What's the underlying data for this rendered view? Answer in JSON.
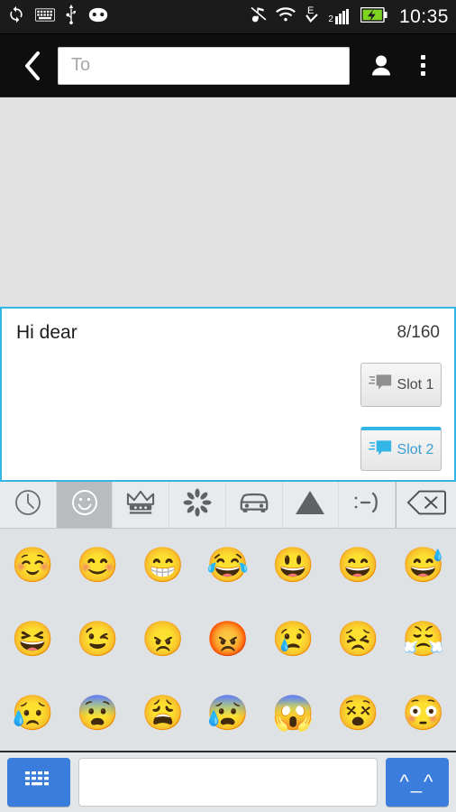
{
  "statusbar": {
    "time": "10:35",
    "signal_label": "2",
    "network_label": "E",
    "left_icons": [
      "sync-icon",
      "keyboard-icon",
      "usb-icon",
      "android-face-icon"
    ],
    "right_icons": [
      "mute-icon",
      "wifi-icon",
      "edge-network-icon",
      "signal-bars-icon",
      "battery-charging-icon"
    ]
  },
  "actionbar": {
    "back_label": "back-chevron",
    "recipient_placeholder": "To",
    "recipient_value": "",
    "contacts_label": "contacts-icon",
    "overflow_label": "overflow-menu-icon"
  },
  "compose": {
    "message": "Hi dear",
    "counter": "8/160",
    "slot1_label": "Slot 1",
    "slot2_label": "Slot 2",
    "accent_color": "#33b5e5",
    "slot2_text_color": "#3b9fd4"
  },
  "keyboard": {
    "categories": [
      {
        "name": "recent",
        "icon": "clock-icon",
        "active": false
      },
      {
        "name": "smileys",
        "icon": "smiley-icon",
        "active": true
      },
      {
        "name": "objects",
        "icon": "crown-icon",
        "active": false
      },
      {
        "name": "nature",
        "icon": "flower-icon",
        "active": false
      },
      {
        "name": "travel",
        "icon": "car-icon",
        "active": false
      },
      {
        "name": "symbols",
        "icon": "triangle-icon",
        "active": false
      },
      {
        "name": "emoticons",
        "icon": "emoticon-icon",
        "label": ":-)",
        "active": false
      }
    ],
    "backspace_label": "backspace-icon",
    "emojis": [
      {
        "name": "relaxed",
        "char": "☺️"
      },
      {
        "name": "blush",
        "char": "😊"
      },
      {
        "name": "grin",
        "char": "😁"
      },
      {
        "name": "joy",
        "char": "😂"
      },
      {
        "name": "smiley",
        "char": "😃"
      },
      {
        "name": "smile",
        "char": "😄"
      },
      {
        "name": "sweat-smile",
        "char": "😅"
      },
      {
        "name": "laughing",
        "char": "😆"
      },
      {
        "name": "wink",
        "char": "😉"
      },
      {
        "name": "angry",
        "char": "😠"
      },
      {
        "name": "rage",
        "char": "😡"
      },
      {
        "name": "cry",
        "char": "😢"
      },
      {
        "name": "persevere",
        "char": "😣"
      },
      {
        "name": "triumph",
        "char": "😤"
      },
      {
        "name": "disappointed-relieved",
        "char": "😥"
      },
      {
        "name": "fearful",
        "char": "😨"
      },
      {
        "name": "weary",
        "char": "😩"
      },
      {
        "name": "cold-sweat",
        "char": "😰"
      },
      {
        "name": "scream",
        "char": "😱"
      },
      {
        "name": "dizzy-face",
        "char": "😵"
      },
      {
        "name": "flushed",
        "char": "😳"
      }
    ]
  },
  "bottombar": {
    "keyboard_key_label": "keyboard-icon",
    "space_value": "",
    "kaomoji_label": "^_^"
  }
}
